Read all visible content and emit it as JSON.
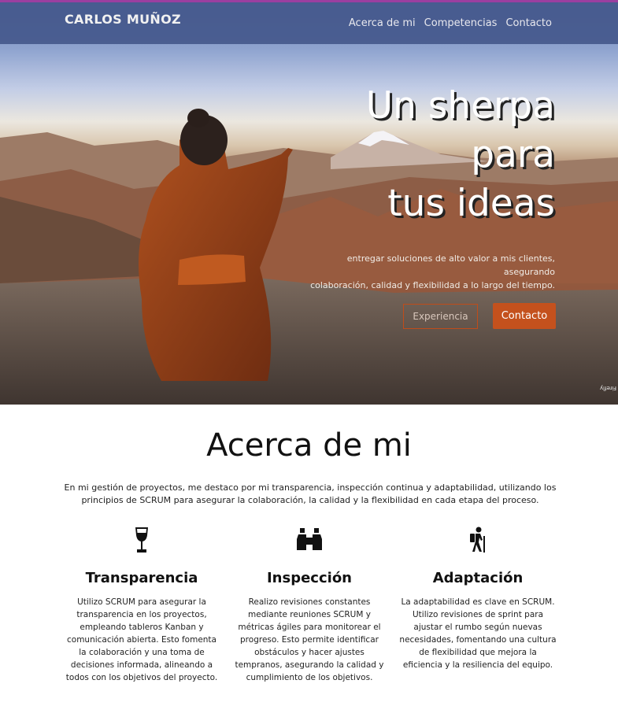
{
  "brand": "CARLOS MUÑOZ",
  "nav": [
    "Acerca de mi",
    "Competencias",
    "Contacto"
  ],
  "hero": {
    "title_lines": [
      "Un sherpa",
      "para",
      "tus ideas"
    ],
    "subtitle_lines": [
      "entregar soluciones de alto valor a mis clientes, asegurando",
      "colaboración, calidad y flexibilidad a lo largo del tiempo."
    ],
    "btn_outline": "Experiencia",
    "btn_solid": "Contacto",
    "credit": "Firefly"
  },
  "about": {
    "title": "Acerca de mi",
    "text": "En mi gestión de proyectos, me destaco por mi transparencia, inspección continua y adaptabilidad, utilizando los principios de SCRUM para asegurar la colaboración, la calidad y la flexibilidad en cada etapa del proceso.",
    "features": [
      {
        "icon": "wine-glass-icon",
        "title": "Transparencia",
        "text": "Utilizo SCRUM para asegurar la transparencia en los proyectos, empleando tableros Kanban y comunicación abierta. Esto fomenta la colaboración y una toma de decisiones informada, alineando a todos con los objetivos del proyecto."
      },
      {
        "icon": "binoculars-icon",
        "title": "Inspección",
        "text": "Realizo revisiones constantes mediante reuniones SCRUM y métricas ágiles para monitorear el progreso. Esto permite identificar obstáculos y hacer ajustes tempranos, asegurando la calidad y cumplimiento de los objetivos."
      },
      {
        "icon": "hiking-icon",
        "title": "Adaptación",
        "text": "La adaptabilidad es clave en SCRUM. Utilizo revisiones de sprint para ajustar el rumbo según nuevas necesidades, fomentando una cultura de flexibilidad que mejora la eficiencia y la resiliencia del equipo."
      }
    ]
  },
  "colors": {
    "navbar": "#44588c",
    "accent": "#c4511d",
    "topline": "#9b3fa0"
  }
}
